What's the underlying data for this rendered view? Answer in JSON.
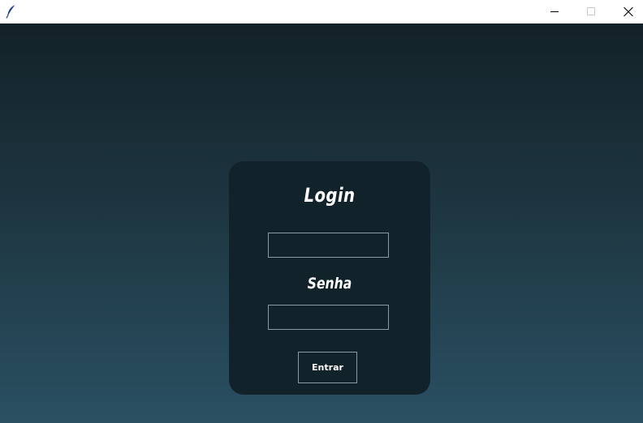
{
  "titlebar": {
    "app_icon": "feather-icon",
    "controls": [
      "minimize-icon",
      "maximize-icon",
      "close-icon"
    ]
  },
  "login": {
    "title": "Login",
    "username_value": "",
    "password_label": "Senha",
    "password_value": "",
    "submit_label": "Entrar"
  },
  "colors": {
    "card": "#12222a",
    "gradient_top": "#132228",
    "gradient_bottom": "#2a5062",
    "field_border": "#8a9aa2",
    "text": "#ffffff"
  }
}
